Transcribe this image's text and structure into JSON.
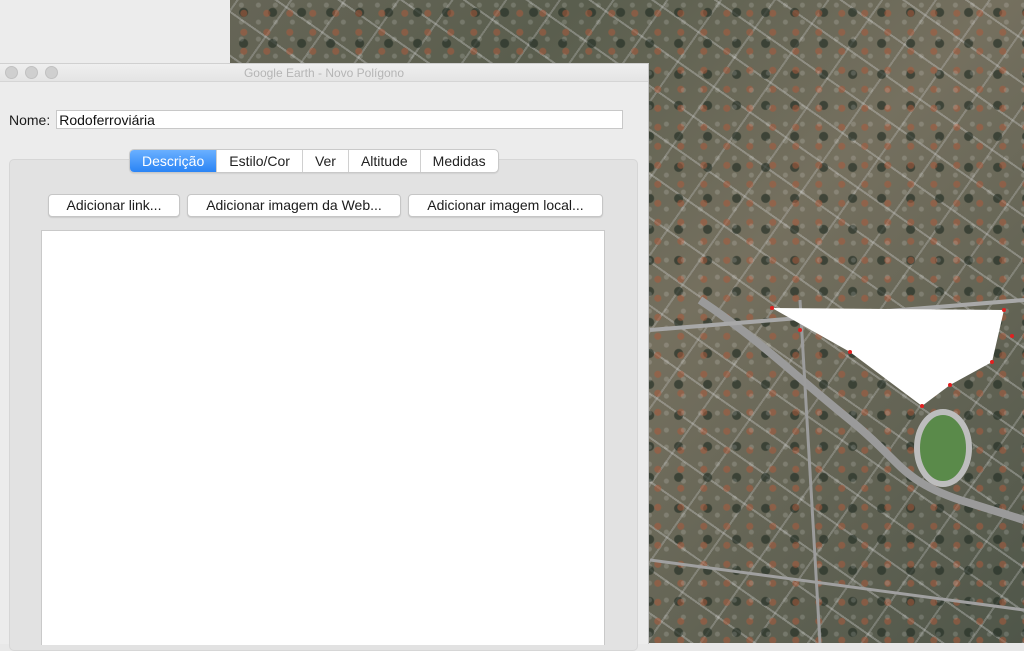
{
  "window": {
    "title": "Google Earth - Novo Polígono"
  },
  "form": {
    "name_label": "Nome:",
    "name_value": "Rodoferroviária"
  },
  "tabs": [
    {
      "label": "Descrição",
      "active": true
    },
    {
      "label": "Estilo/Cor",
      "active": false
    },
    {
      "label": "Ver",
      "active": false
    },
    {
      "label": "Altitude",
      "active": false
    },
    {
      "label": "Medidas",
      "active": false
    }
  ],
  "buttons": {
    "add_link": "Adicionar link...",
    "add_web_image": "Adicionar imagem da Web...",
    "add_local_image": "Adicionar imagem local..."
  },
  "description": {
    "value": ""
  },
  "colors": {
    "active_tab": "#2a84f5",
    "polygon_fill": "#ffffff",
    "vertex_marker": "#e02020"
  },
  "map": {
    "polygon_vertex_count": 8
  }
}
